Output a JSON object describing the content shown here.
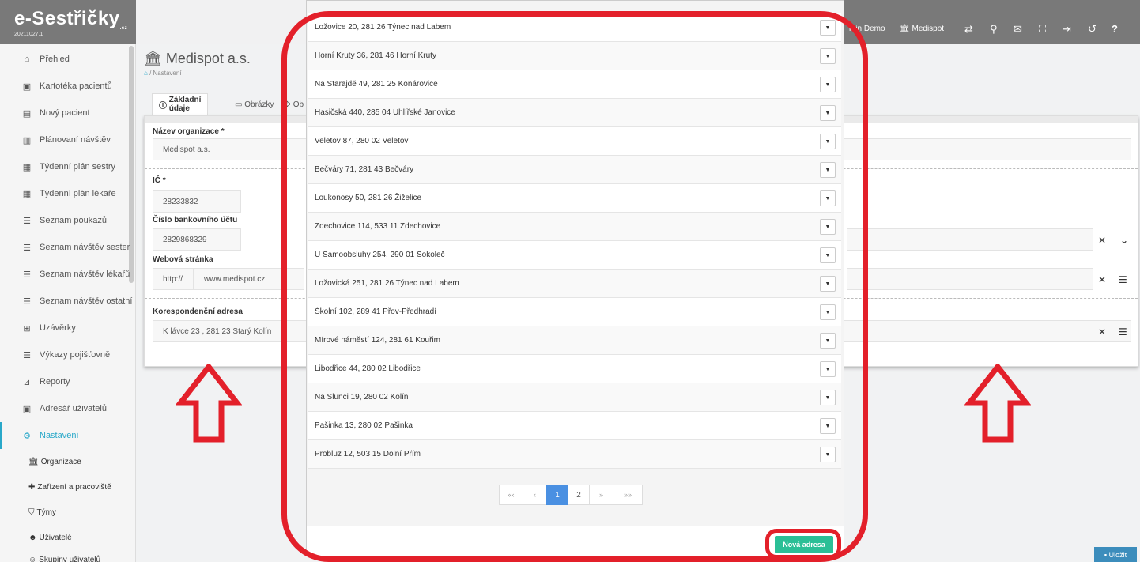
{
  "app": {
    "logo": "e-Sestřičky",
    "logo_suffix": ".cz",
    "version": "20211027.1"
  },
  "topbar": {
    "user": "min Demo",
    "org": "Medispot",
    "icons": [
      "swap-icon",
      "search-icon",
      "mail-icon",
      "fullscreen-icon",
      "logout-icon",
      "history-icon",
      "help-icon"
    ]
  },
  "sidebar": {
    "items": [
      {
        "label": "Přehled",
        "icon": "home-icon"
      },
      {
        "label": "Kartotéka pacientů",
        "icon": "card-icon"
      },
      {
        "label": "Nový pacient",
        "icon": "id-card-icon"
      },
      {
        "label": "Plánovaní návštěv",
        "icon": "map-icon"
      },
      {
        "label": "Týdenní plán sestry",
        "icon": "calendar-icon"
      },
      {
        "label": "Týdenní plán lékaře",
        "icon": "calendar-icon"
      },
      {
        "label": "Seznam poukazů",
        "icon": "list-icon"
      },
      {
        "label": "Seznam návštěv sester",
        "icon": "list-icon"
      },
      {
        "label": "Seznam návštěv lékařů",
        "icon": "list-icon"
      },
      {
        "label": "Seznam návštěv ostatní",
        "icon": "list-icon"
      },
      {
        "label": "Uzávěrky",
        "icon": "table-icon"
      },
      {
        "label": "Výkazy pojišťovně",
        "icon": "list-icon"
      },
      {
        "label": "Reporty",
        "icon": "report-icon"
      },
      {
        "label": "Adresář uživatelů",
        "icon": "address-book-icon"
      },
      {
        "label": "Nastavení",
        "icon": "gears-icon"
      }
    ],
    "sub_items": [
      {
        "label": "Organizace",
        "icon": "bank-icon"
      },
      {
        "label": "Zařízení a pracoviště",
        "icon": "hospital-icon"
      },
      {
        "label": "Týmy",
        "icon": "shield-icon"
      },
      {
        "label": "Uživatelé",
        "icon": "user-icon"
      },
      {
        "label": "Skupiny uživatelů",
        "icon": "users-icon"
      }
    ]
  },
  "page": {
    "title": "Medispot a.s.",
    "breadcrumb": "Nastavení",
    "tabs": [
      "Základní údaje",
      "Obrázky",
      "Ob"
    ],
    "fields": {
      "org_name_label": "Název organizace *",
      "org_name_value": "Medispot a.s.",
      "ic_label": "IČ *",
      "ic_value": "28233832",
      "bank_label": "Číslo bankovního účtu",
      "bank_value": "2829868329",
      "web_label": "Webová stránka",
      "web_prefix": "http://",
      "web_value": "www.medispot.cz",
      "addr_label": "Korespondenční adresa",
      "addr_value": "K lávce 23 , 281 23 Starý Kolín"
    },
    "save_label": "Uložit"
  },
  "modal": {
    "addresses": [
      "Ložovice 20, 281 26 Týnec nad Labem",
      "Horní Kruty 36, 281 46 Horní Kruty",
      "Na Starajdě 49, 281 25 Konárovice",
      "Hasičská 440, 285 04 Uhlířské Janovice",
      "Veletov 87, 280 02 Veletov",
      "Bečváry 71, 281 43 Bečváry",
      "Loukonosy 50, 281 26 Žiželice",
      "Zdechovice 114, 533 11 Zdechovice",
      "U Samoobsluhy 254, 290 01 Sokoleč",
      "Ložovická 251, 281 26 Týnec nad Labem",
      "Školní 102, 289 41 Přov-Předhradí",
      "Mírové náměstí 124, 281 61 Kouřim",
      "Libodřice 44, 280 02 Libodřice",
      "Na Slunci 19, 280 02 Kolín",
      "Pašinka 13, 280 02 Pašinka",
      "Probluz 12, 503 15 Dolní Přím"
    ],
    "pagination": {
      "first": "«‹",
      "prev": "‹",
      "pages": [
        "1",
        "2"
      ],
      "current": "1",
      "next": "»",
      "last": "»»"
    },
    "new_button": "Nová adresa"
  },
  "annotations": {
    "highlight_color": "#e3202a"
  }
}
